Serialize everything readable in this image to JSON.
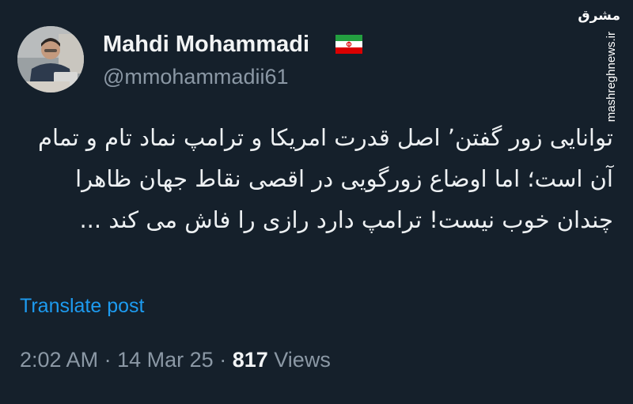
{
  "author": {
    "display_name": "Mahdi Mohammadi",
    "handle": "@mmohammadii61",
    "flag": "iran-flag"
  },
  "post": {
    "text": "توانایی زور گفتن’ اصل قدرت امریکا و ترامپ نماد تام و تمام آن است؛ اما اوضاع زورگویی در اقصی نقاط جهان ظاهرا چندان خوب نیست! ترامپ دارد رازی را فاش می کند ...",
    "translate_label": "Translate post",
    "time": "2:02 AM",
    "separator": "·",
    "date": "14 Mar 25",
    "views_count": "817",
    "views_label": "Views"
  },
  "watermark": {
    "logo_text": "مشرق",
    "url": "mashreghnews.ir"
  },
  "colors": {
    "background": "#15202b",
    "primary_text": "#e7e9ea",
    "secondary_text": "#8b98a5",
    "accent": "#1d9bf0"
  }
}
